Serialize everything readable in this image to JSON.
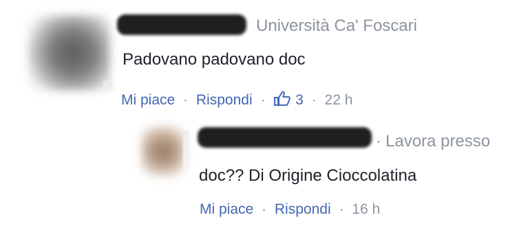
{
  "comment": {
    "affiliation": "Università Ca' Foscari",
    "text": "Padovano padovano doc",
    "actions": {
      "like_label": "Mi piace",
      "reply_label": "Rispondi",
      "like_count": "3",
      "time": "22 h"
    }
  },
  "reply": {
    "affiliation": "Lavora presso",
    "text": "doc?? Di Origine Cioccolatina",
    "actions": {
      "like_label": "Mi piace",
      "reply_label": "Rispondi",
      "time": "16 h"
    }
  },
  "separator": "·",
  "colors": {
    "link": "#4267b2",
    "meta": "#8d949e",
    "text": "#1d2129",
    "redaction": "#1f1f1f"
  },
  "icons": {
    "like": "thumbs-up-icon"
  }
}
